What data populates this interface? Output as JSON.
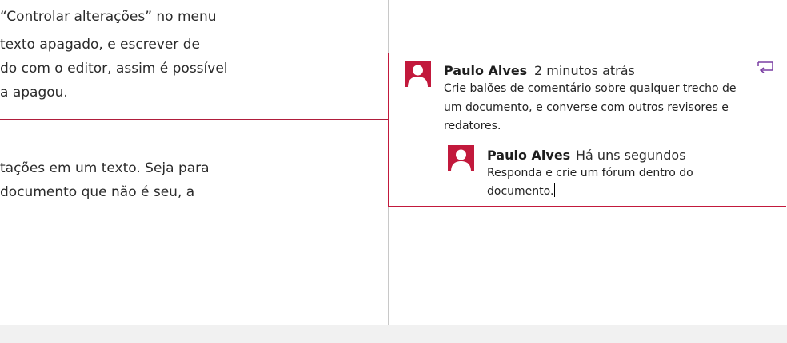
{
  "document": {
    "lines": [
      "“Controlar alterações” no menu",
      " texto apagado, e escrever de",
      "do com o editor, assim é possível",
      " a apagou.",
      "tações em um texto. Seja para",
      " documento que não é seu, a"
    ]
  },
  "comment": {
    "author": "Paulo Alves",
    "time": "2 minutos atrás",
    "lines": [
      "Crie balões de comentário sobre qualquer trecho de",
      "um documento, e converse com outros revisores e",
      "redatores."
    ],
    "reply_icon": "reply-comment-icon",
    "reply": {
      "author": "Paulo Alves",
      "time": "Há uns segundos",
      "lines": [
        "Responda e crie um fórum dentro do",
        "documento."
      ]
    }
  },
  "colors": {
    "accent": "#c2193c",
    "reply_icon": "#7a3ea3"
  }
}
